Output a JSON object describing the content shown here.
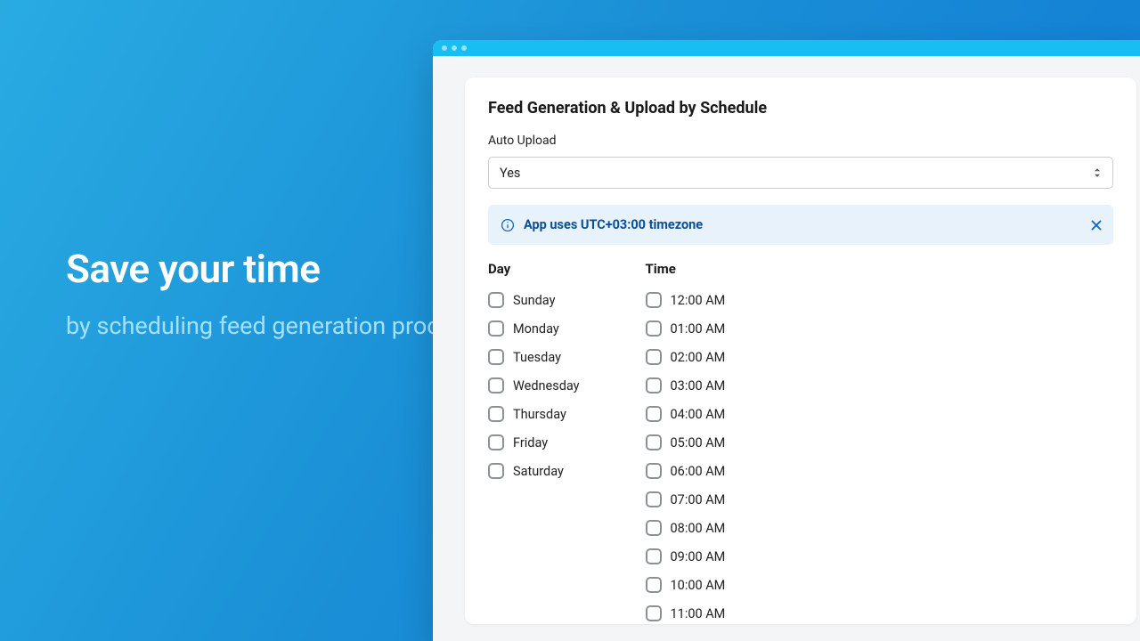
{
  "promo": {
    "headline": "Save your time",
    "subhead": "by scheduling feed generation process"
  },
  "panel": {
    "title": "Feed Generation & Upload by Schedule",
    "auto_upload_label": "Auto Upload",
    "auto_upload_value": "Yes",
    "banner_text": "App uses UTC+03:00 timezone",
    "day_header": "Day",
    "time_header": "Time",
    "days": [
      "Sunday",
      "Monday",
      "Tuesday",
      "Wednesday",
      "Thursday",
      "Friday",
      "Saturday"
    ],
    "times": [
      "12:00 AM",
      "01:00 AM",
      "02:00 AM",
      "03:00 AM",
      "04:00 AM",
      "05:00 AM",
      "06:00 AM",
      "07:00 AM",
      "08:00 AM",
      "09:00 AM",
      "10:00 AM",
      "11:00 AM"
    ]
  },
  "colors": {
    "accent": "#18bdf1",
    "banner_bg": "#e8f2fb",
    "banner_text": "#0a4f95"
  }
}
